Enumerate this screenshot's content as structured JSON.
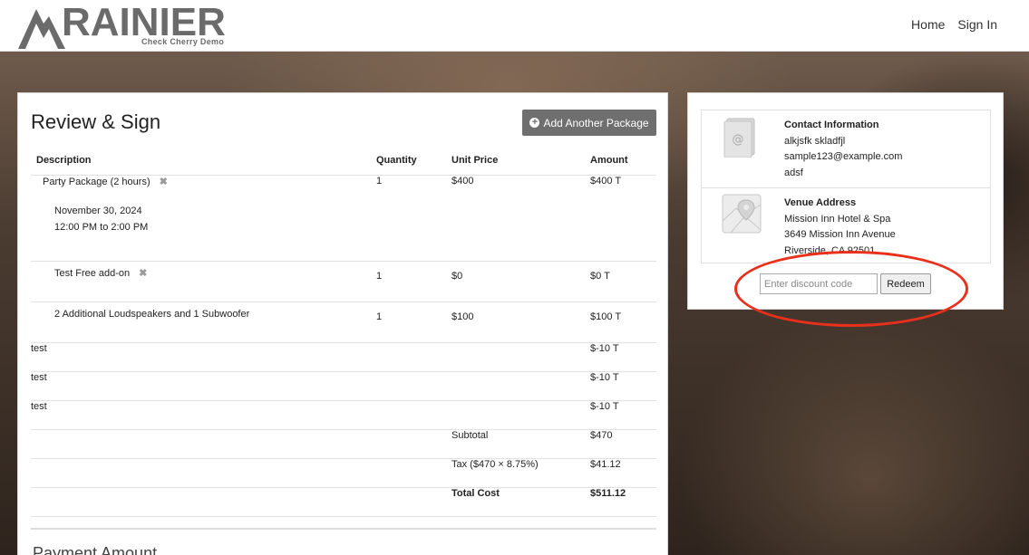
{
  "header": {
    "logo_text": "RAINIER",
    "logo_subtitle": "Check Cherry Demo",
    "nav": {
      "home": "Home",
      "sign_in": "Sign In"
    }
  },
  "review": {
    "title": "Review & Sign",
    "add_package_label": "Add Another Package",
    "columns": {
      "description": "Description",
      "quantity": "Quantity",
      "unit_price": "Unit Price",
      "amount": "Amount"
    },
    "package": {
      "name": "Party Package (2 hours)",
      "date": "November 30, 2024",
      "time": "12:00 PM to 2:00 PM",
      "quantity": "1",
      "unit_price": "$400",
      "amount": "$400 T"
    },
    "addons": [
      {
        "name": "Test Free add-on",
        "quantity": "1",
        "unit_price": "$0",
        "amount": "$0 T",
        "removable": true
      },
      {
        "name": "2 Additional Loudspeakers and 1 Subwoofer",
        "quantity": "1",
        "unit_price": "$100",
        "amount": "$100 T",
        "removable": false
      }
    ],
    "discounts": [
      {
        "name": "test",
        "amount": "$-10 T"
      },
      {
        "name": "test",
        "amount": "$-10 T"
      },
      {
        "name": "test",
        "amount": "$-10 T"
      }
    ],
    "subtotal_label": "Subtotal",
    "subtotal": "$470",
    "tax_label": "Tax ($470 × 8.75%)",
    "tax": "$41.12",
    "total_label": "Total Cost",
    "total": "$511.12",
    "next_section_title": "Payment Amount"
  },
  "sidebar": {
    "contact": {
      "title": "Contact Information",
      "name": "alkjsfk skladfjl",
      "email": "sample123@example.com",
      "extra": "adsf"
    },
    "venue": {
      "title": "Venue Address",
      "name": "Mission Inn Hotel & Spa",
      "street": "3649 Mission Inn Avenue",
      "city": "Riverside, CA 92501"
    },
    "discount_placeholder": "Enter discount code",
    "redeem_label": "Redeem"
  },
  "colors": {
    "highlight": "#e8301c",
    "button_gray": "#6f6f6f",
    "logo_gray": "#6b6b6b"
  }
}
